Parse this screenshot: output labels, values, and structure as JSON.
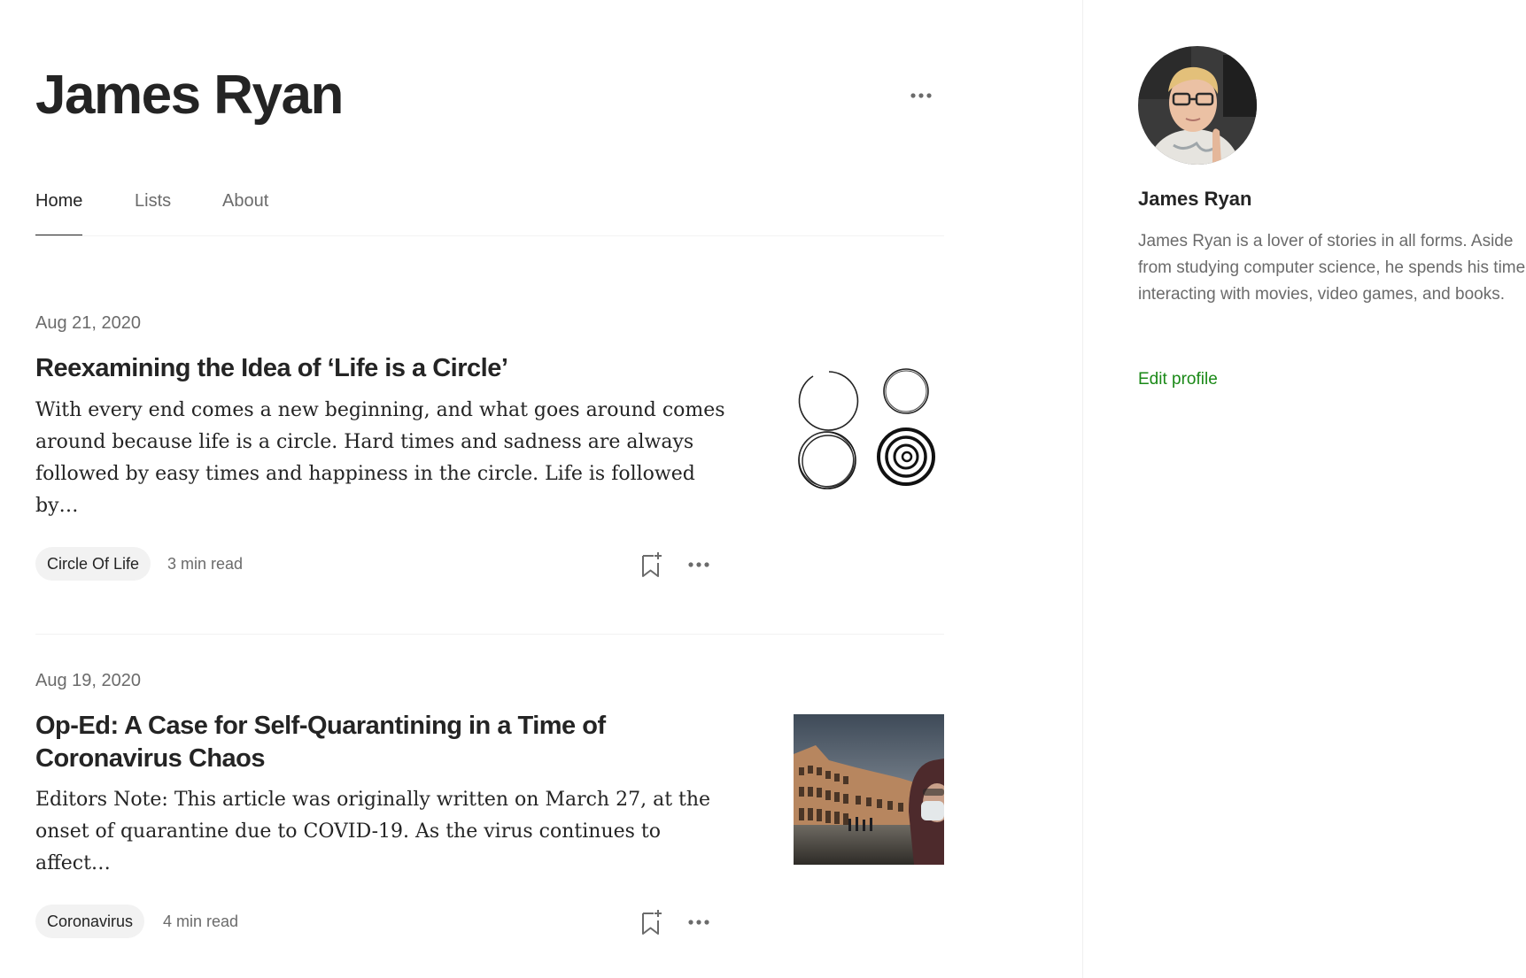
{
  "profile": {
    "title": "James Ryan",
    "tabs": [
      {
        "label": "Home",
        "active": true
      },
      {
        "label": "Lists",
        "active": false
      },
      {
        "label": "About",
        "active": false
      }
    ]
  },
  "articles": [
    {
      "date": "Aug 21, 2020",
      "title": "Reexamining the Idea of ‘Life is a Circle’",
      "excerpt": "With every end comes a new beginning, and what goes around comes around because life is a circle. Hard times and sadness are always followed by easy times and happiness in the circle. Life is followed by…",
      "tag": "Circle Of Life",
      "read_time": "3 min read",
      "thumbnail_icon": "circles-drawing"
    },
    {
      "date": "Aug 19, 2020",
      "title": "Op-Ed: A Case for Self-Quarantining in a Time of Coronavirus Chaos",
      "excerpt": "Editors Note: This article was originally written on March 27, at the onset of quarantine due to COVID-19. As the virus continues to affect…",
      "tag": "Coronavirus",
      "read_time": "4 min read",
      "thumbnail_icon": "colosseum-photo"
    }
  ],
  "sidebar": {
    "name": "James Ryan",
    "bio": "James Ryan is a lover of stories in all forms. Aside from studying computer science, he spends his time interacting with movies, video games, and books.",
    "edit_label": "Edit profile",
    "avatar_icon": "avatar-photo"
  },
  "colors": {
    "text": "#242424",
    "muted": "#6b6b6b",
    "accent": "#1a8917",
    "tag_bg": "#f2f2f2"
  }
}
